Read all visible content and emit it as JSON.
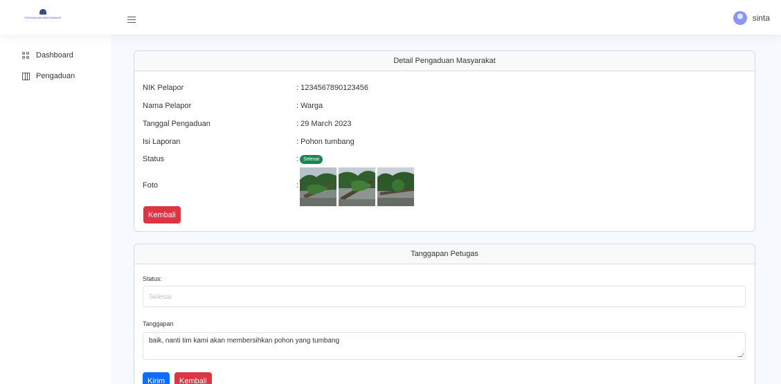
{
  "header": {
    "logo_text": "PENGADUAN MASYARAKAT",
    "user_name": "sinta"
  },
  "sidebar": {
    "items": [
      {
        "label": "Dashboard",
        "icon": "grid-icon"
      },
      {
        "label": "Pengaduan",
        "icon": "table-icon"
      }
    ]
  },
  "detail": {
    "title": "Detail Pengaduan Masyarakat",
    "rows": [
      {
        "key": "NIK Pelapor",
        "value": ": 1234567890123456"
      },
      {
        "key": "Nama Pelapor",
        "value": ": Warga"
      },
      {
        "key": "Tanggal Pengaduan",
        "value": ": 29 March 2023"
      },
      {
        "key": "Isi Laporan",
        "value": ": Pohon tumbang"
      }
    ],
    "status_key": "Status",
    "status_prefix": ":",
    "status_badge": "Selesai",
    "status_color": "#198754",
    "foto_key": "Foto",
    "foto_prefix": ":",
    "back_label": "Kembali"
  },
  "response": {
    "title": "Tanggapan Petugas",
    "status_label": "Status:",
    "status_placeholder": "Selesai",
    "tanggapan_label": "Tanggapan",
    "tanggapan_value": "baik, nanti tim kami akan membersihkan pohon yang tumbang",
    "submit_label": "Kirim",
    "back_label": "Kembali"
  },
  "colors": {
    "primary": "#0d6efd",
    "danger": "#dc3545",
    "success": "#198754",
    "background": "#f6f9ff"
  }
}
